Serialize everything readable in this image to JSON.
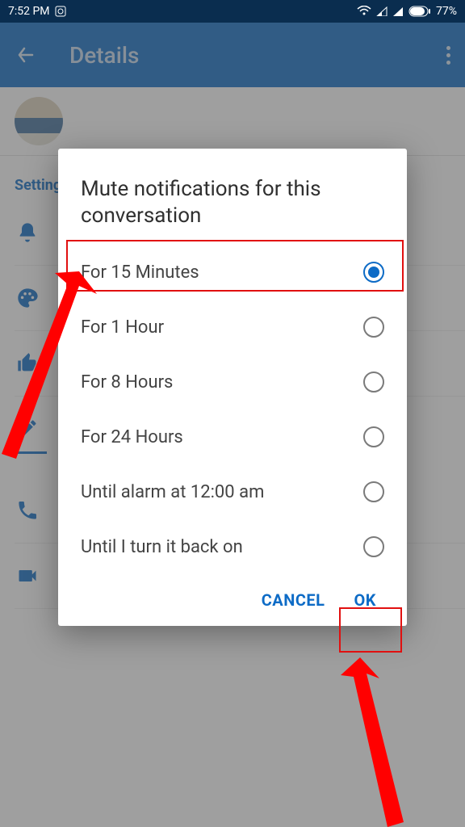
{
  "status": {
    "time": "7:52 PM",
    "battery": "77%"
  },
  "header": {
    "title": "Details"
  },
  "settings": {
    "label": "Settings",
    "items": [
      {
        "label": ""
      },
      {
        "label": ""
      },
      {
        "label": ""
      },
      {
        "label": ""
      },
      {
        "label": ""
      },
      {
        "label": "Video call"
      }
    ]
  },
  "modal": {
    "title": "Mute notifications for this conversation",
    "options": [
      {
        "label": "For 15 Minutes",
        "selected": true
      },
      {
        "label": "For 1 Hour",
        "selected": false
      },
      {
        "label": "For 8 Hours",
        "selected": false
      },
      {
        "label": "For 24 Hours",
        "selected": false
      },
      {
        "label": "Until alarm at 12:00 am",
        "selected": false
      },
      {
        "label": "Until I turn it back on",
        "selected": false
      }
    ],
    "cancel": "CANCEL",
    "ok": "OK"
  }
}
